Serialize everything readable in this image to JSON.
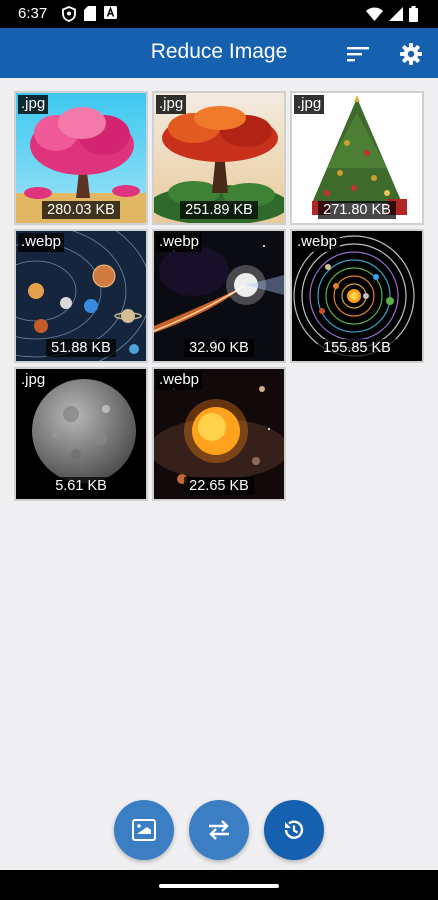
{
  "status_bar": {
    "time": "6:37",
    "icons": [
      "shield-icon",
      "sd-card-icon",
      "a-icon",
      "wifi-icon",
      "signal-icon",
      "battery-icon"
    ]
  },
  "app_bar": {
    "title": "Reduce Image",
    "actions": [
      "sort-icon",
      "settings-icon"
    ],
    "color": "#1660b0"
  },
  "images": [
    {
      "ext": ".jpg",
      "size": "280.03 KB",
      "subject": "pink tree"
    },
    {
      "ext": ".jpg",
      "size": "251.89 KB",
      "subject": "red tree"
    },
    {
      "ext": ".jpg",
      "size": "271.80 KB",
      "subject": "christmas tree"
    },
    {
      "ext": ".webp",
      "size": "51.88 KB",
      "subject": "solar system"
    },
    {
      "ext": ".webp",
      "size": "32.90 KB",
      "subject": "comet"
    },
    {
      "ext": ".webp",
      "size": "155.85 KB",
      "subject": "planet orbits"
    },
    {
      "ext": ".jpg",
      "size": "5.61 KB",
      "subject": "moon"
    },
    {
      "ext": ".webp",
      "size": "22.65 KB",
      "subject": "sun"
    }
  ],
  "fabs": [
    "image-icon",
    "swap-icon",
    "history-icon"
  ]
}
